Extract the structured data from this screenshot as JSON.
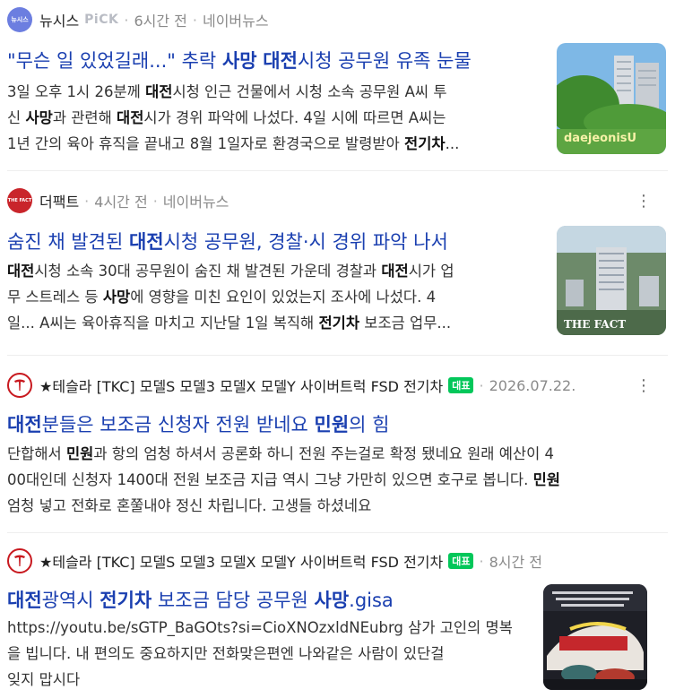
{
  "results": [
    {
      "source": "뉴시스",
      "pick": "PiCK",
      "time": "6시간 전",
      "platform": "네이버뉴스",
      "logo_text": "뉴시스",
      "title_parts": [
        "\"무슨 일 있었길래...\" 추락 ",
        "사망",
        " ",
        "대전",
        "시청 공무원 유족 눈물"
      ],
      "desc_line1_parts": [
        "3일 오후 1시 26분께 ",
        "대전",
        "시청 인근 건물에서 시청 소속 공무원 A씨 투"
      ],
      "desc_line2_parts": [
        "신 ",
        "사망",
        "과 관련해 ",
        "대전",
        "시가 경위 파악에 나섰다. 4일 시에 따르면 A씨는"
      ],
      "desc_line3_parts": [
        "1년 간의 육아 휴직을 끝내고 8월 1일자로 환경국으로 발령받아 ",
        "전기차",
        "..."
      ],
      "thumb_text": "daejeonisU"
    },
    {
      "source": "더팩트",
      "time": "4시간 전",
      "platform": "네이버뉴스",
      "logo_text": "THE FACT",
      "title_parts": [
        "숨진 채 발견된 ",
        "대전",
        "시청 공무원, 경찰·시 경위 파악 나서"
      ],
      "desc_line1_parts": [
        "대전",
        "시청 소속 30대 공무원이 숨진 채 발견된 가운데 경찰과 ",
        "대전",
        "시가 업"
      ],
      "desc_line2_parts": [
        "무 스트레스 등 ",
        "사망",
        "에 영향을 미친 요인이 있었는지 조사에 나섰다. 4"
      ],
      "desc_line3_parts": [
        "일... A씨는 육아휴직을 마치고 지난달 1일 복직해 ",
        "전기차",
        " 보조금 업무..."
      ],
      "thumb_text": "THE FACT"
    },
    {
      "source": "★테슬라 [TKC] 모델S 모델3 모델X 모델Y 사이버트럭 FSD 전기차",
      "badge": "대표",
      "time": "2026.07.22.",
      "title_parts": [
        "대전",
        "분들은 보조금 신청자 전원 받네요 ",
        "민원",
        "의 힘"
      ],
      "desc_line1_parts": [
        "단합해서 ",
        "민원",
        "과 항의 엄청 하셔서 공론화 하니 전원 주는걸로 확정 됐네요 원래 예산이 4"
      ],
      "desc_line2_parts": [
        "00대인데 신청자 1400대 전원 보조금 지급 역시 그냥 가만히 있으면 호구로 봅니다. ",
        "민원"
      ],
      "desc_line3_parts": [
        "엄청 넣고 전화로 혼쭐내야 정신 차립니다. 고생들 하셨네요"
      ]
    },
    {
      "source": "★테슬라 [TKC] 모델S 모델3 모델X 모델Y 사이버트럭 FSD 전기차",
      "badge": "대표",
      "time": "8시간 전",
      "title_parts": [
        "대전",
        "광역시 ",
        "전기차",
        " 보조금 담당 공무원 ",
        "사망",
        ".gisa"
      ],
      "desc_line1_parts": [
        "https://youtu.be/sGTP_BaGOts?si=CioXNOzxldNEubrg 삼가 고인의 명복"
      ],
      "desc_line2_parts": [
        "을 빕니다. 내 편의도 중요하지만 전화맞은편엔 나와같은 사람이 있단걸"
      ],
      "desc_line3_parts": [
        "잊지 맙시다"
      ]
    }
  ],
  "more_icon": "⋮",
  "colors": {
    "title": "#1a3fb0",
    "badge": "#03c75a",
    "tesla_red": "#c8191f"
  }
}
